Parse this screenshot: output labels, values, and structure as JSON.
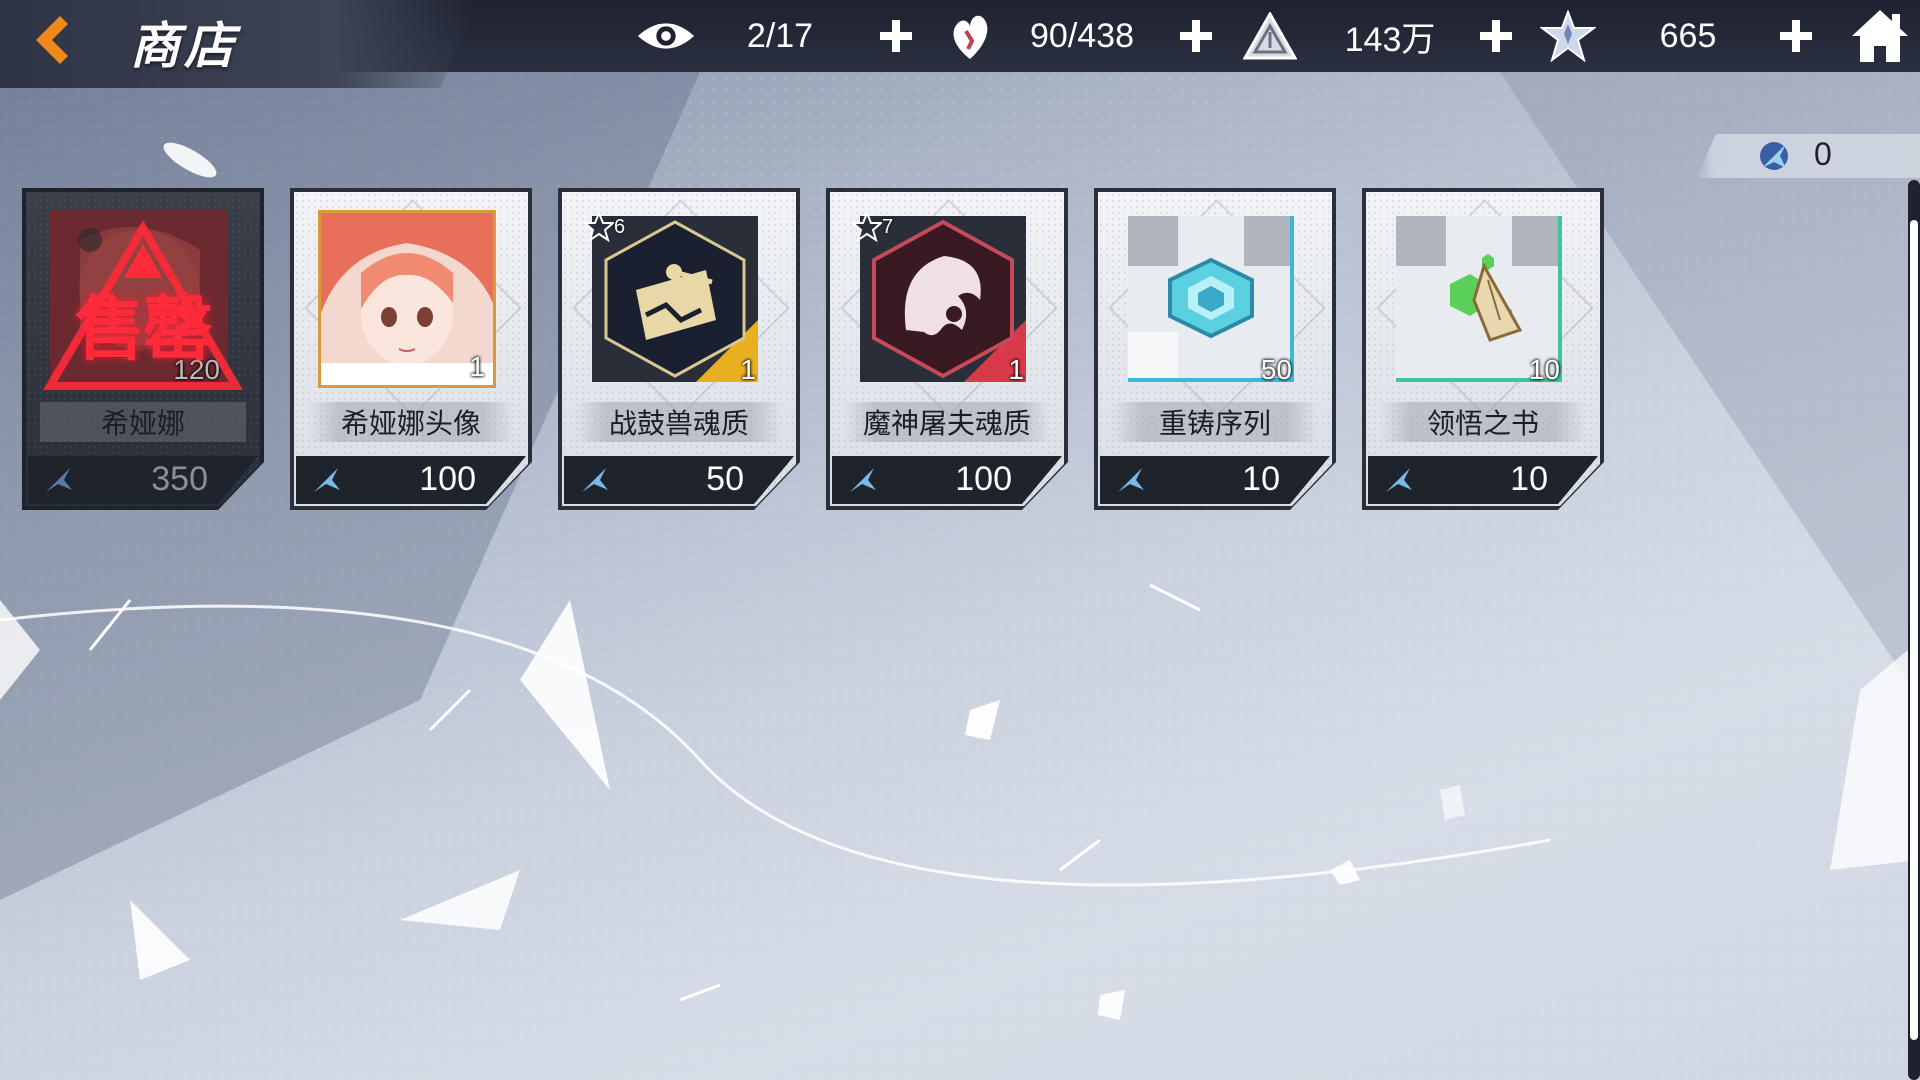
{
  "header": {
    "title": "商店",
    "back_icon": "chevron-left-icon",
    "home_icon": "home-icon"
  },
  "resources": [
    {
      "id": "view-count",
      "icon": "eye-icon",
      "value": "2/17"
    },
    {
      "id": "stamina",
      "icon": "heart-flame-icon",
      "value": "90/438"
    },
    {
      "id": "gold",
      "icon": "triangle-coin-icon",
      "value": "143万"
    },
    {
      "id": "crystal",
      "icon": "star-crystal-icon",
      "value": "665"
    }
  ],
  "shop_currency": {
    "icon": "shop-token-icon",
    "value": "0"
  },
  "items": [
    {
      "name": "希娅娜",
      "price": "350",
      "qty": "120",
      "stars": "",
      "sold_out": true,
      "sold_label": "售罄",
      "icon": "character-portrait-icon",
      "accent": "#ff2a3a"
    },
    {
      "name": "希娅娜头像",
      "price": "100",
      "qty": "1",
      "stars": "",
      "sold_out": false,
      "icon": "avatar-portrait-icon",
      "accent": "#d89a3a"
    },
    {
      "name": "战鼓兽魂质",
      "price": "50",
      "qty": "1",
      "stars": "6",
      "sold_out": false,
      "icon": "drum-beast-soul-icon",
      "accent": "#e8b020"
    },
    {
      "name": "魔神屠夫魂质",
      "price": "100",
      "qty": "1",
      "stars": "7",
      "sold_out": false,
      "icon": "demon-butcher-soul-icon",
      "accent": "#d83a4a"
    },
    {
      "name": "重铸序列",
      "price": "10",
      "qty": "50",
      "stars": "",
      "sold_out": false,
      "icon": "recast-hex-icon",
      "accent": "#3ab8d8"
    },
    {
      "name": "领悟之书",
      "price": "10",
      "qty": "10",
      "stars": "",
      "sold_out": false,
      "icon": "insight-book-icon",
      "accent": "#3ac898"
    }
  ],
  "price_icon": "shop-token-icon"
}
